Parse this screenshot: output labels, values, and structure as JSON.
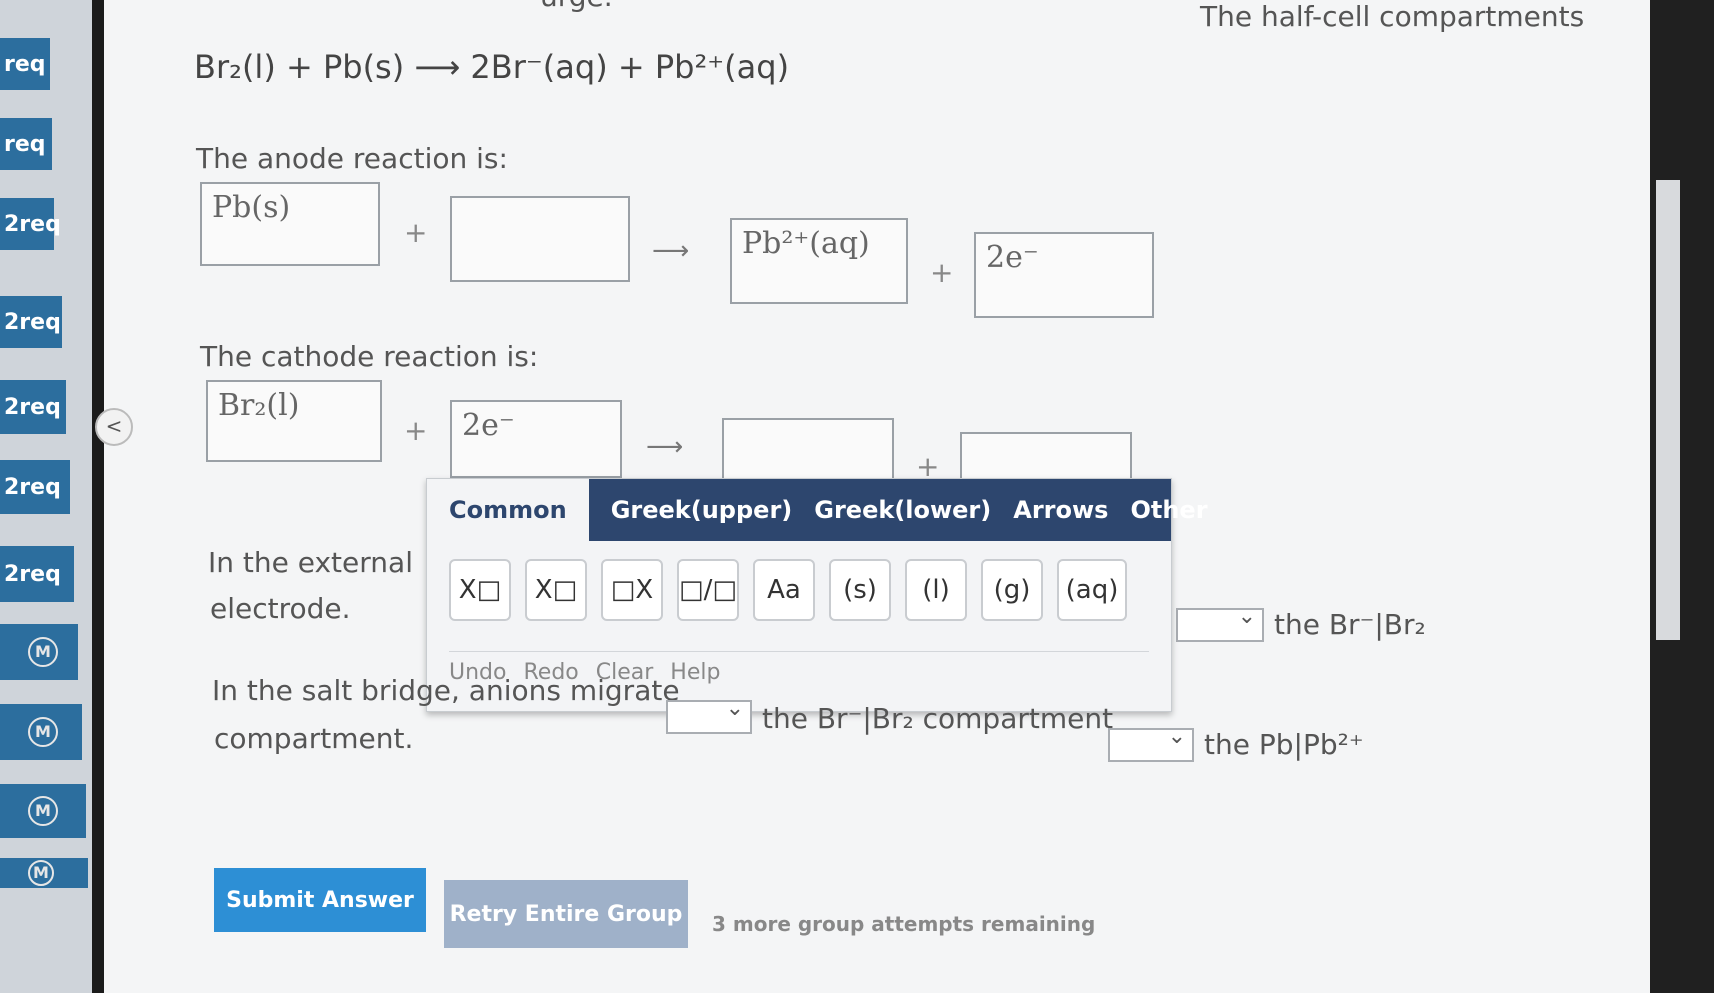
{
  "sidebar": {
    "items": [
      {
        "label": "req"
      },
      {
        "label": "req"
      },
      {
        "label": "2req"
      },
      {
        "label": "2req"
      },
      {
        "label": "2req"
      },
      {
        "label": "2req"
      },
      {
        "label": "2req"
      },
      {
        "label": "M"
      },
      {
        "label": "M"
      },
      {
        "label": "M"
      },
      {
        "label": "M"
      }
    ],
    "collapse_label": "<"
  },
  "question": {
    "top_fragment": "urge.",
    "top_right_fragment": "The half-cell compartments",
    "overall_equation": "Br₂(l) + Pb(s) ⟶ 2Br⁻(aq) + Pb²⁺(aq)",
    "anode_label": "The anode reaction is:",
    "anode": {
      "reactant1": "Pb(s)",
      "reactant2": "",
      "product1": "Pb²⁺(aq)",
      "product2": "2e⁻"
    },
    "cathode_label": "The cathode reaction is:",
    "cathode": {
      "reactant1": "Br₂(l)",
      "reactant2": "2e⁻",
      "product1": "",
      "product2": ""
    },
    "plus": "+",
    "arrow": "⟶",
    "external_line1": "In the external",
    "external_line2": "electrode.",
    "external_tail": "the Br⁻|Br₂",
    "salt_line1": "In the salt bridge, anions migrate",
    "salt_mid": "the Br⁻|Br₂ compartment",
    "salt_tail": "the Pb|Pb²⁺",
    "salt_line2": "compartment."
  },
  "palette": {
    "tabs": [
      "Common",
      "Greek(upper)",
      "Greek(lower)",
      "Arrows",
      "Other"
    ],
    "keys": [
      "X□",
      "X□",
      "□X",
      "□/□",
      "Aa",
      "(s)",
      "(l)",
      "(g)",
      "(aq)"
    ],
    "actions": [
      "Undo",
      "Redo",
      "Clear",
      "Help"
    ]
  },
  "footer": {
    "submit_label": "Submit Answer",
    "retry_label": "Retry Entire Group",
    "attempts_text": "3 more group attempts remaining"
  },
  "colors": {
    "accent": "#2d8fd5",
    "palette_header": "#2d466e",
    "nav": "#2c6e9e"
  }
}
